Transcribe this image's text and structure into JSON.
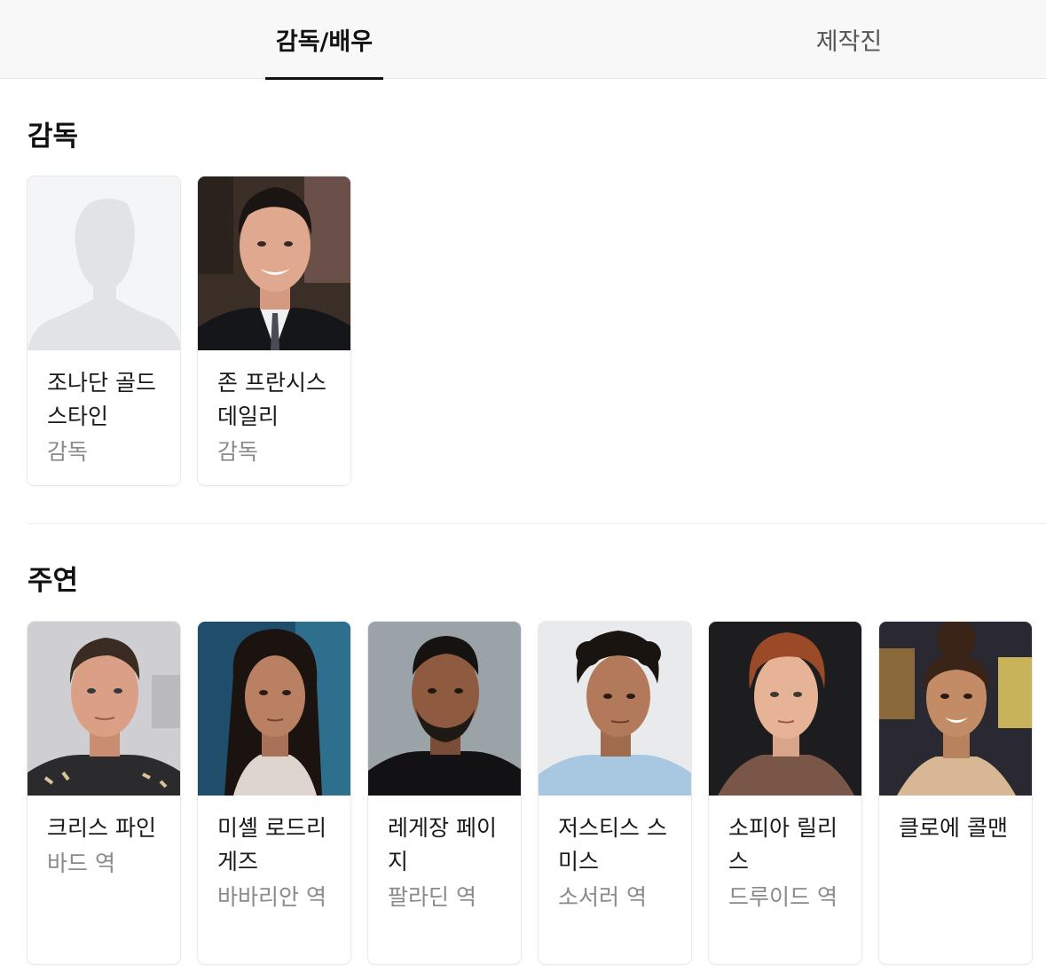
{
  "tabs": [
    {
      "label": "감독/배우",
      "active": true
    },
    {
      "label": "제작진",
      "active": false
    }
  ],
  "sections": {
    "directors": {
      "title": "감독",
      "people": [
        {
          "name": "조나단 골드스타인",
          "role": "감독",
          "photo": "placeholder-silhouette"
        },
        {
          "name": "존 프란시스 데일리",
          "role": "감독",
          "photo": "portrait"
        }
      ]
    },
    "cast": {
      "title": "주연",
      "people": [
        {
          "name": "크리스 파인",
          "role": "바드 역",
          "photo": "portrait"
        },
        {
          "name": "미셸 로드리게즈",
          "role": "바바리안 역",
          "photo": "portrait"
        },
        {
          "name": "레게장 페이지",
          "role": "팔라딘 역",
          "photo": "portrait"
        },
        {
          "name": "저스티스 스미스",
          "role": "소서러 역",
          "photo": "portrait"
        },
        {
          "name": "소피아 릴리스",
          "role": "드루이드 역",
          "photo": "portrait"
        },
        {
          "name": "클로에 콜맨",
          "role": "",
          "photo": "portrait"
        }
      ]
    }
  },
  "colors": {
    "tab_active": "#111111",
    "tab_inactive": "#555555",
    "role_text": "#8a8a8a",
    "tabbar_bg": "#f8f8f9"
  }
}
